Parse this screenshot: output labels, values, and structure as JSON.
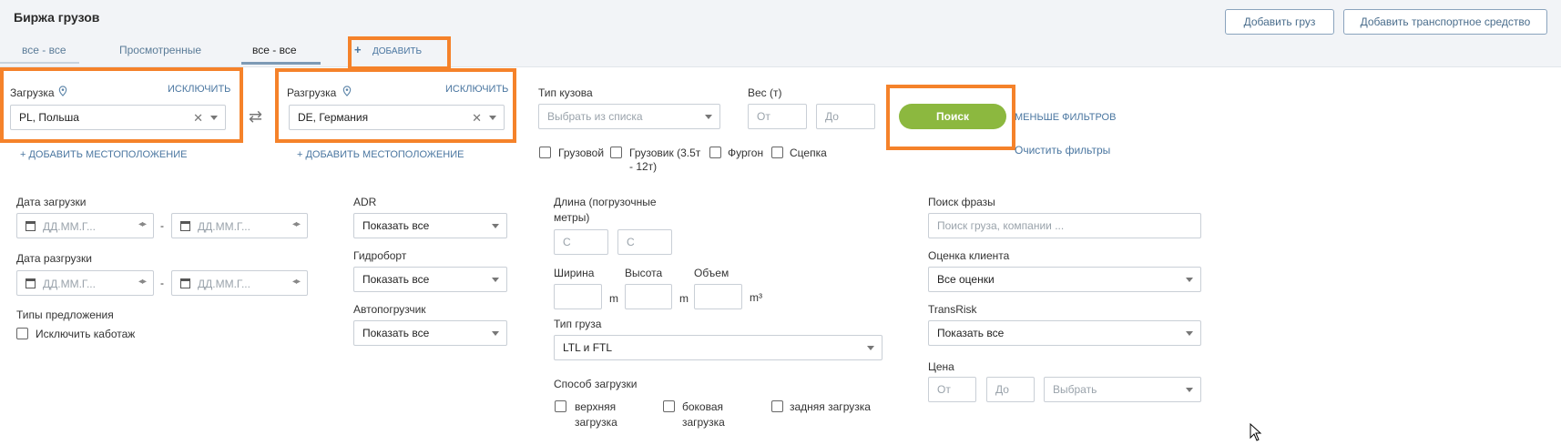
{
  "header": {
    "title": "Биржа грузов",
    "add_cargo": "Добавить груз",
    "add_vehicle": "Добавить транспортное средство"
  },
  "tabs": [
    {
      "label": "все - все"
    },
    {
      "label": "Просмотренные"
    },
    {
      "label": "все - все"
    },
    {
      "label": "ДОБАВИТЬ"
    }
  ],
  "loading": {
    "label": "Загрузка",
    "exclude": "ИСКЛЮЧИТЬ",
    "value": "PL,  Польша",
    "add_location": "ДОБАВИТЬ МЕСТОПОЛОЖЕНИЕ"
  },
  "unloading": {
    "label": "Разгрузка",
    "exclude": "ИСКЛЮЧИТЬ",
    "value": "DE,  Германия",
    "add_location": "ДОБАВИТЬ МЕСТОПОЛОЖЕНИЕ"
  },
  "body_type": {
    "label": "Тип кузова",
    "placeholder": "Выбрать из списка",
    "options": [
      "Грузовой",
      "Грузовик (3.5т - 12т)",
      "Фургон",
      "Сцепка"
    ],
    "option_lines": [
      "Грузовик (3.5т",
      "- 12т)"
    ]
  },
  "weight": {
    "label": "Вес (т)",
    "from": "От",
    "to": "До"
  },
  "search_button": "Поиск",
  "fewer_filters": "МЕНЬШЕ ФИЛЬТРОВ",
  "clear_filters": "Очистить фильтры",
  "load_date": {
    "label": "Дата загрузки",
    "placeholder": "ДД.ММ.Г...",
    "dash": "-"
  },
  "unload_date": {
    "label": "Дата разгрузки",
    "placeholder": "ДД.ММ.Г...",
    "dash": "-"
  },
  "offer_types": {
    "label": "Типы предложения",
    "exclude_cabotage": "Исключить каботаж"
  },
  "adr": {
    "label": "ADR",
    "value": "Показать все"
  },
  "tail_lift": {
    "label": "Гидроборт",
    "value": "Показать все"
  },
  "forklift": {
    "label": "Автопогрузчик",
    "value": "Показать все"
  },
  "length": {
    "label_line1": "Длина (погрузочные",
    "label_line2": "метры)",
    "from": "С",
    "to": "С"
  },
  "width": {
    "label": "Ширина",
    "unit": "m"
  },
  "height": {
    "label": "Высота",
    "unit": "m"
  },
  "volume": {
    "label": "Объем",
    "unit": "m³"
  },
  "cargo_type": {
    "label": "Тип груза",
    "value": "LTL и FTL"
  },
  "loading_method": {
    "label": "Способ загрузки",
    "top_line1": "верхняя",
    "top_line2": "загрузка",
    "side_line1": "боковая",
    "side_line2": "загрузка",
    "rear": "задняя загрузка"
  },
  "phrase_search": {
    "label": "Поиск фразы",
    "placeholder": "Поиск груза, компании ..."
  },
  "client_rating": {
    "label": "Оценка клиента",
    "value": "Все оценки"
  },
  "transrisk": {
    "label": "TransRisk",
    "value": "Показать все"
  },
  "price": {
    "label": "Цена",
    "from": "От",
    "to": "До",
    "select": "Выбрать"
  },
  "colors": {
    "highlight": "#f5822a",
    "search_button": "#8cb83f",
    "link": "#4a76a0"
  }
}
